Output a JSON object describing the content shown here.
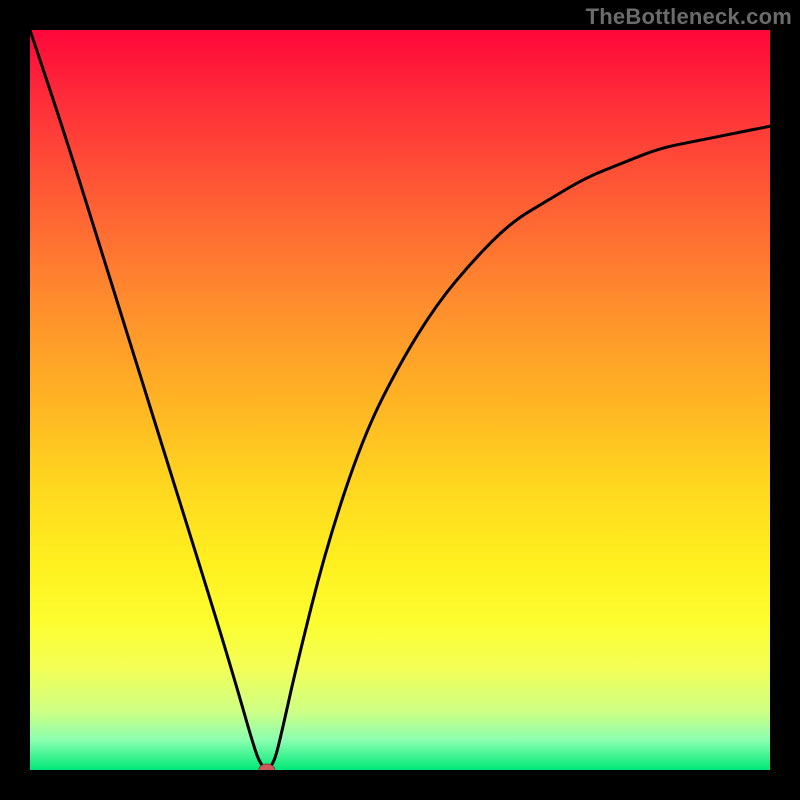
{
  "watermark": "TheBottleneck.com",
  "chart_data": {
    "type": "line",
    "title": "",
    "xlabel": "",
    "ylabel": "",
    "xlim": [
      0,
      100
    ],
    "ylim": [
      0,
      100
    ],
    "grid": false,
    "legend": false,
    "background_gradient": {
      "top": "#ff073a",
      "middle": "#ffd81f",
      "bottom": "#00e878"
    },
    "series": [
      {
        "name": "bottleneck-curve",
        "color": "#000000",
        "x": [
          0,
          5,
          10,
          15,
          20,
          25,
          28,
          30,
          31,
          32,
          33,
          34,
          36,
          40,
          45,
          50,
          55,
          60,
          65,
          70,
          75,
          80,
          85,
          90,
          95,
          100
        ],
        "y": [
          100,
          85,
          69,
          53,
          37,
          21,
          11,
          4,
          1,
          0,
          1,
          5,
          14,
          30,
          45,
          55,
          63,
          69,
          74,
          77,
          80,
          82,
          84,
          85,
          86,
          87
        ]
      }
    ],
    "marker": {
      "name": "minimum-point",
      "x": 32,
      "y": 0,
      "color": "#cc5a5a",
      "rx": 8,
      "ry": 6
    }
  }
}
